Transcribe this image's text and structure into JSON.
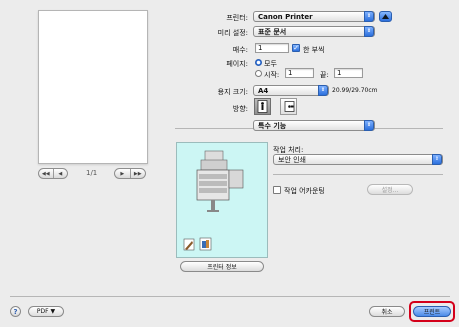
{
  "preview": {
    "page_indicator": "1/1",
    "nav_first": "◀◀",
    "nav_prev": "◀",
    "nav_next": "▶",
    "nav_last": "▶▶"
  },
  "printer": {
    "label": "프린터:",
    "value": "Canon Printer"
  },
  "presets": {
    "label": "미리 설정:",
    "value": "표준 문서"
  },
  "copies": {
    "label": "매수:",
    "value": "1",
    "collate_label": "한 부씩",
    "collate_checked": true
  },
  "pages": {
    "label": "페이지:",
    "all_label": "모두",
    "from_label": "시작:",
    "from_value": "1",
    "to_label": "끝:",
    "to_value": "1"
  },
  "paper_size": {
    "label": "용지 크기:",
    "value": "A4",
    "dimensions": "20.99/29.70cm"
  },
  "orientation": {
    "label": "방향:"
  },
  "section_popup": {
    "value": "특수 기능"
  },
  "job_processing": {
    "label": "작업 처리:",
    "value": "보안 인쇄"
  },
  "job_accounting": {
    "label": "작업 어카운팅",
    "checked": false,
    "settings_button": "설정..."
  },
  "printer_info_button": "프린터 정보",
  "footer": {
    "help_icon": "?",
    "pdf_button": "PDF ▼",
    "cancel_button": "취소",
    "print_button": "프린트"
  },
  "colors": {
    "accent": "#2c6fdc",
    "highlight_ring": "#d4001a",
    "preview_bg": "#ccf6f4"
  }
}
